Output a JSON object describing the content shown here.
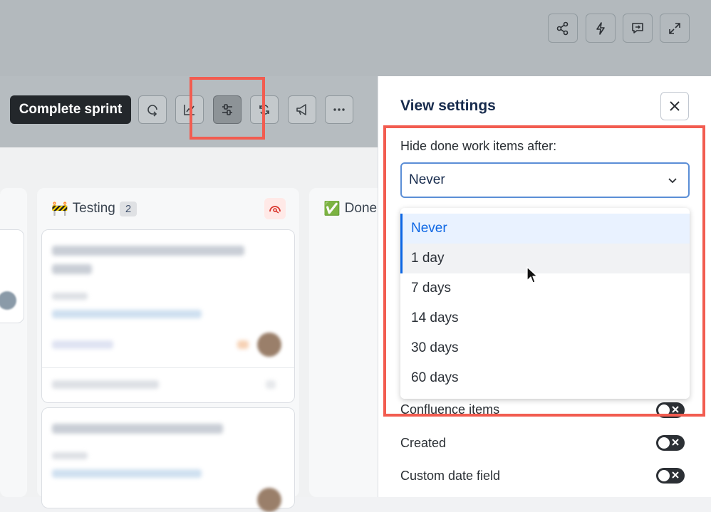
{
  "toolbar": {
    "complete_sprint_label": "Complete sprint"
  },
  "board": {
    "columns": [
      {
        "emoji": "🚧",
        "title": "Testing",
        "count": "2"
      },
      {
        "emoji": "✅",
        "title": "Done"
      }
    ]
  },
  "panel": {
    "title": "View settings",
    "hide_done_label": "Hide done work items after:",
    "select_value": "Never",
    "options": [
      "Never",
      "1 day",
      "7 days",
      "14 days",
      "30 days",
      "60 days"
    ],
    "toggles": [
      {
        "label": "Confluence items"
      },
      {
        "label": "Created"
      },
      {
        "label": "Custom date field"
      }
    ]
  },
  "colors": {
    "accent": "#0c66e4",
    "highlight": "#f25c50",
    "toggle_bg": "#2c3035"
  }
}
